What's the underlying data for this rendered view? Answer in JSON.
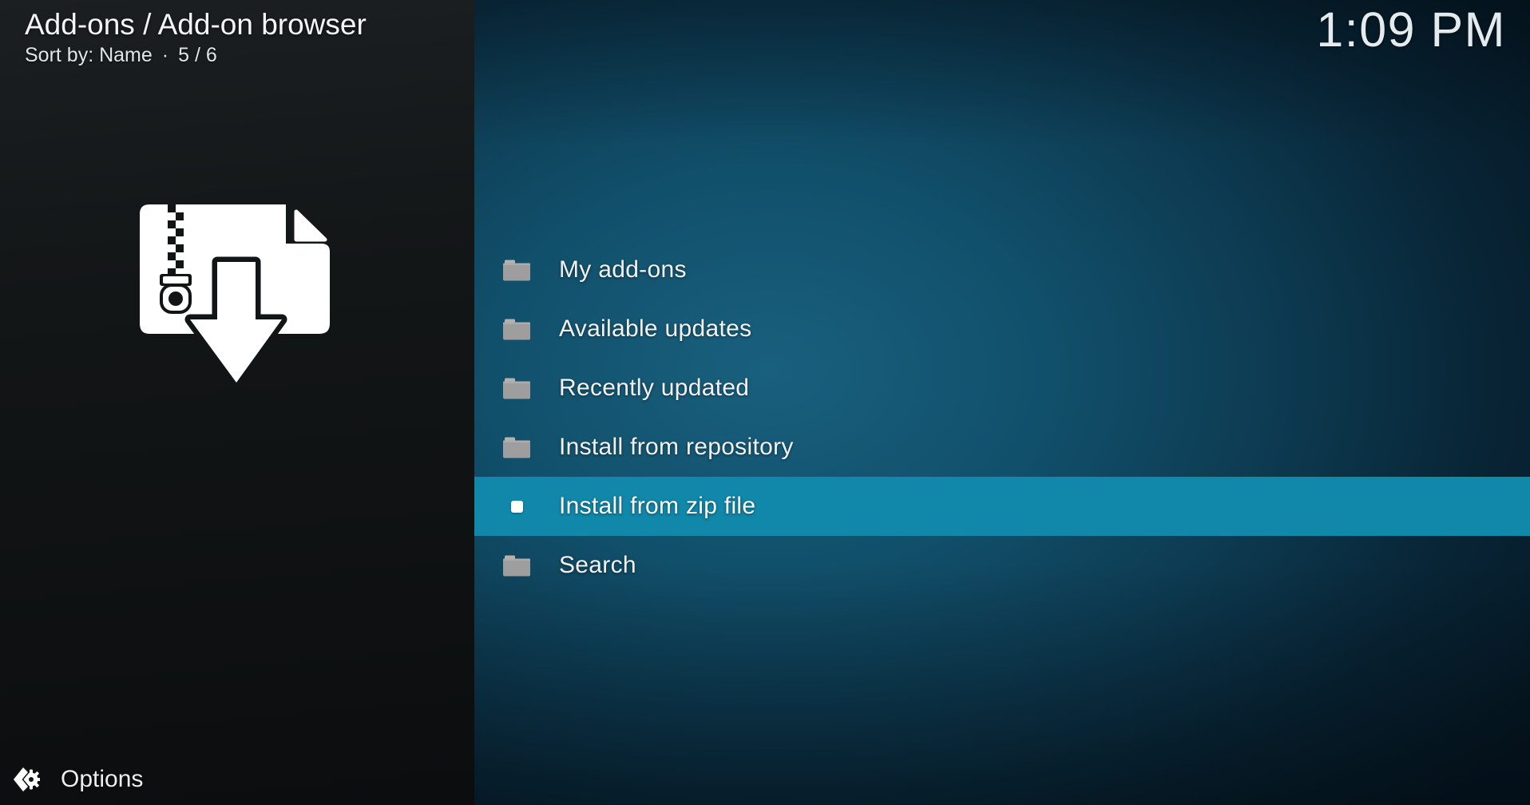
{
  "header": {
    "title": "Add-ons / Add-on browser",
    "sort_label": "Sort by: Name",
    "separator": "·",
    "item_position": "5 / 6"
  },
  "clock": {
    "time": "1:09 PM"
  },
  "sidebar": {
    "artwork_icon": "zip-file-download-icon",
    "options_label": "Options"
  },
  "menu": {
    "items": [
      {
        "label": "My add-ons",
        "icon": "folder-icon",
        "selected": false
      },
      {
        "label": "Available updates",
        "icon": "folder-icon",
        "selected": false
      },
      {
        "label": "Recently updated",
        "icon": "folder-icon",
        "selected": false
      },
      {
        "label": "Install from repository",
        "icon": "folder-icon",
        "selected": false
      },
      {
        "label": "Install from zip file",
        "icon": "square-bullet-icon",
        "selected": true
      },
      {
        "label": "Search",
        "icon": "folder-icon",
        "selected": false
      }
    ]
  },
  "colors": {
    "highlight": "#1187a9",
    "sidebar_bg": "#121516",
    "panel_center": "#19607e",
    "panel_edge": "#051723",
    "folder_icon": "#9e9e9e",
    "text": "#f2f2f2"
  }
}
